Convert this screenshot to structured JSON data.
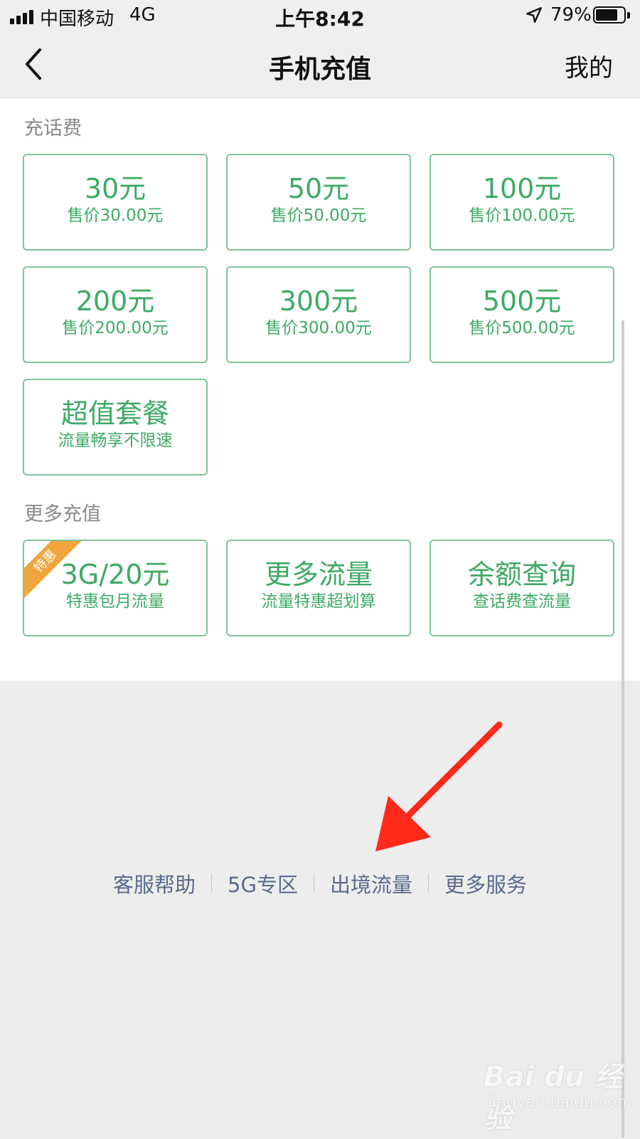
{
  "status_bar": {
    "carrier": "中国移动",
    "network": "4G",
    "time": "上午8:42",
    "battery": "79%",
    "battery_level": 0.79
  },
  "nav": {
    "title": "手机充值",
    "right": "我的",
    "back_icon": "chevron-left-icon"
  },
  "recharge": {
    "title": "充话费",
    "items": [
      {
        "amount": "30元",
        "price": "售价30.00元"
      },
      {
        "amount": "50元",
        "price": "售价50.00元"
      },
      {
        "amount": "100元",
        "price": "售价100.00元"
      },
      {
        "amount": "200元",
        "price": "售价200.00元"
      },
      {
        "amount": "300元",
        "price": "售价300.00元"
      },
      {
        "amount": "500元",
        "price": "售价500.00元"
      },
      {
        "amount": "超值套餐",
        "price": "流量畅享不限速"
      }
    ]
  },
  "more": {
    "title": "更多充值",
    "items": [
      {
        "main": "3G/20元",
        "sub": "特惠包月流量",
        "badge": "特惠"
      },
      {
        "main": "更多流量",
        "sub": "流量特惠超划算"
      },
      {
        "main": "余额查询",
        "sub": "查话费查流量"
      }
    ]
  },
  "footer": {
    "links": [
      "客服帮助",
      "5G专区",
      "出境流量",
      "更多服务"
    ]
  },
  "watermark": {
    "main": "Bai du 经验",
    "sub": "jingyan.baidu.com"
  },
  "colors": {
    "accent": "#3daa63",
    "border": "#7fc39a",
    "badge": "#f0a63a",
    "arrow": "#ff2a1a",
    "link": "#5b6b8c"
  }
}
